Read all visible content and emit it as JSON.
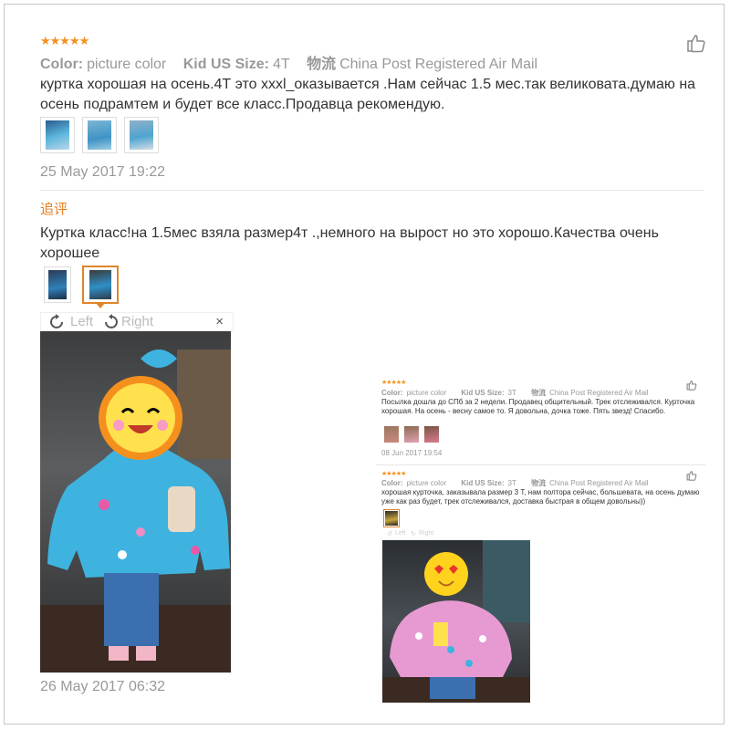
{
  "review1": {
    "rating_stars": "★★★★★",
    "color_label": "Color:",
    "color_value": "picture color",
    "size_label": "Kid US Size:",
    "size_value": "4T",
    "ship_label": "物流",
    "ship_value": "China Post Registered Air Mail",
    "text": "куртка хорошая на осень.4Т это xxxl_оказывается .Нам сейчас 1.5 мес.так великовата.думаю на осень подрамтем и будет все класс.Продавца рекомендую.",
    "date": "25 May 2017 19:22",
    "followup_label": "追评",
    "followup_text": "Куртка класс!на 1.5мес взяла размер4т .,немного на вырост но это хорошо.Качества очень хорошее",
    "rotate_left": "Left",
    "rotate_right": "Right",
    "close": "×",
    "followup_date": "26 May 2017 06:32"
  },
  "review2": {
    "rating_stars": "★★★★★",
    "color_label": "Color:",
    "color_value": "picture color",
    "size_label": "Kid US Size:",
    "size_value": "3T",
    "ship_label": "物流",
    "ship_value": "China Post Registered Air Mail",
    "text": "Посылка дошла до СПб за 2 недели. Продавец общительный. Трек отслеживался. Курточка хорошая. На осень - весну самое то. Я довольна, дочка тоже. Пять звезд! Спасибо.",
    "date": "08 Jun 2017 19:54"
  },
  "review3": {
    "rating_stars": "★★★★★",
    "color_label": "Color:",
    "color_value": "picture color",
    "size_label": "Kid US Size:",
    "size_value": "3T",
    "ship_label": "物流",
    "ship_value": "China Post Registered Air Mail",
    "text": "хорошая курточка, заказывала размер 3 Т, нам полтора сейчас, большевата, на осень думаю уже как раз будет, трек отслеживался, доставка быстрая в общем довольны))",
    "rotate_left": "Left",
    "rotate_right": "Right"
  },
  "colors": {
    "star": "#f5901e",
    "accent": "#e0842c",
    "jacket_blue": "#3eb3df",
    "jacket_pink": "#e79ad2"
  }
}
